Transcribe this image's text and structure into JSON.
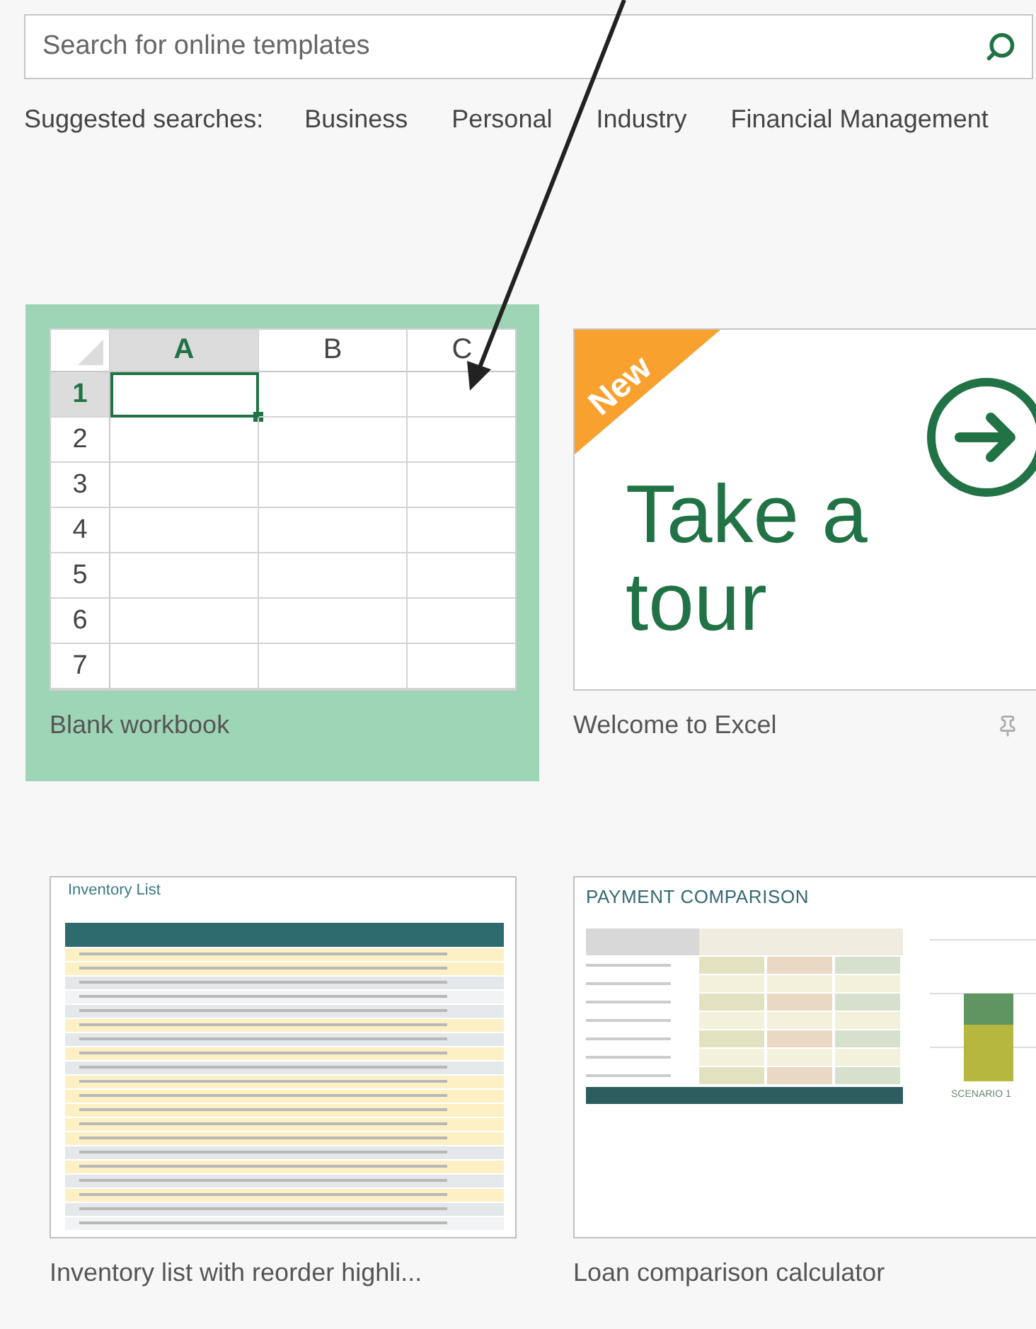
{
  "search": {
    "placeholder": "Search for online templates"
  },
  "suggested": {
    "label": "Suggested searches:",
    "items": [
      "Business",
      "Personal",
      "Industry",
      "Financial Management"
    ]
  },
  "templates": [
    {
      "kind": "blank",
      "name": "Blank workbook",
      "selected": true,
      "columns": [
        {
          "label": "A",
          "selected": true
        },
        {
          "label": "B",
          "selected": false
        },
        {
          "label": "C",
          "selected": false
        }
      ],
      "rows": [
        {
          "label": "1",
          "selected": true
        },
        {
          "label": "2",
          "selected": false
        },
        {
          "label": "3",
          "selected": false
        },
        {
          "label": "4",
          "selected": false
        },
        {
          "label": "5",
          "selected": false
        },
        {
          "label": "6",
          "selected": false
        },
        {
          "label": "7",
          "selected": false
        }
      ]
    },
    {
      "kind": "tour",
      "name": "Welcome to Excel",
      "selected": false,
      "badge": "New",
      "lines": [
        "Take a",
        "tour"
      ]
    },
    {
      "kind": "inventory",
      "name": "Inventory list with reorder highli...",
      "selected": false,
      "title": "Inventory List"
    },
    {
      "kind": "loan",
      "name": "Loan comparison calculator",
      "selected": false,
      "title": "PAYMENT COMPARISON",
      "chart_label": "SCENARIO 1"
    }
  ]
}
